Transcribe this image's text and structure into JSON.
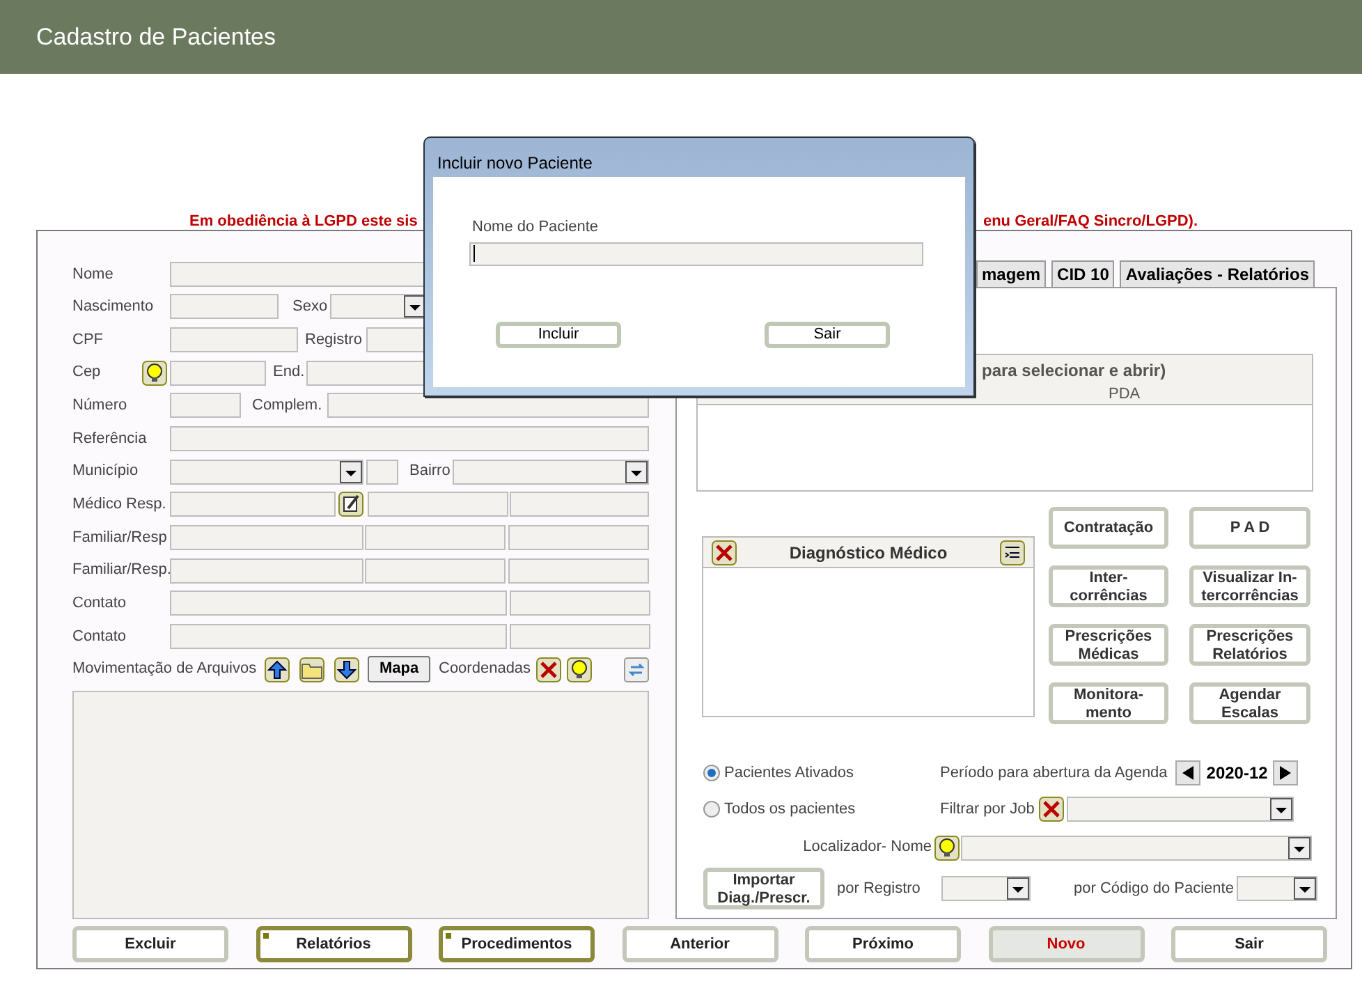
{
  "header": {
    "title": "Cadastro de Pacientes"
  },
  "notice": {
    "start": "Em obediência à LGPD este sis",
    "end": "enu Geral/FAQ Sincro/LGPD)."
  },
  "form": {
    "nome": "Nome",
    "nascimento": "Nascimento",
    "sexo": "Sexo",
    "cpf": "CPF",
    "registro": "Registro",
    "cep": "Cep",
    "end": "End.",
    "numero": "Número",
    "complem": "Complem.",
    "referencia": "Referência",
    "municipio": "Município",
    "bairro": "Bairro",
    "medico": "Médico Resp.",
    "familiar_1": "Familiar/Resp",
    "familiar_2": "Familiar/Resp.",
    "contato_1": "Contato",
    "contato_2": "Contato",
    "arquivos": "Movimentação de Arquivos",
    "mapa_button": "Mapa",
    "coordenadas": "Coordenadas"
  },
  "tabs": [
    {
      "label": "magem",
      "selected": false
    },
    {
      "label": "CID 10",
      "selected": false
    },
    {
      "label": "Avaliações - Relatórios",
      "selected": false
    }
  ],
  "jobs_table": {
    "caption": "para selecionar e abrir)",
    "columns": [
      "PDA"
    ]
  },
  "diagnosis": {
    "title": "Diagnóstico Médico"
  },
  "action_buttons": [
    "Contratação",
    "P A D",
    "Inter-\ncorrências",
    "Visualizar In-\ntercorrências",
    "Prescrições\nMédicas",
    "Prescrições\nRelatórios",
    "Monitora-\nmento",
    "Agendar\nEscalas"
  ],
  "filters": {
    "radios": [
      {
        "label": "Pacientes Ativados",
        "selected": true
      },
      {
        "label": "Todos os pacientes",
        "selected": false
      }
    ],
    "period_label": "Período para abertura da Agenda",
    "period_value": "2020-12",
    "job_label": "Filtrar por Job",
    "locator_label": "Localizador- Nome",
    "import_button": "Importar\nDiag./Prescr.",
    "registro_label": "por Registro",
    "codigo_label": "por Código do Paciente"
  },
  "footer_buttons": [
    {
      "label": "Excluir",
      "kind": "plain"
    },
    {
      "label": "Relatórios",
      "kind": "menu"
    },
    {
      "label": "Procedimentos",
      "kind": "menu"
    },
    {
      "label": "Anterior",
      "kind": "plain"
    },
    {
      "label": "Próximo",
      "kind": "plain"
    },
    {
      "label": "Novo",
      "kind": "current"
    },
    {
      "label": "Sair",
      "kind": "plain"
    }
  ],
  "dialog": {
    "title": "Incluir novo Paciente",
    "field_label": "Nome do Paciente",
    "buttons": [
      "Incluir",
      "Sair"
    ]
  }
}
